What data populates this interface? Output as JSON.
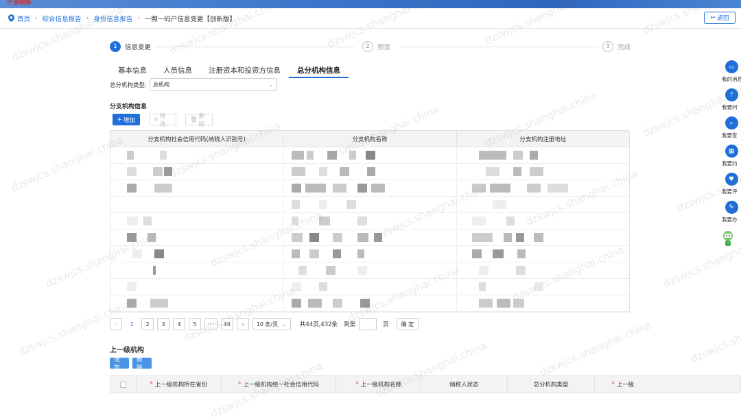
{
  "logo_text": "宁波税务",
  "breadcrumb": [
    "首页",
    "综合信息报告",
    "身份信息报告",
    "一照一码户信息变更【创新版】"
  ],
  "back_label": "返回",
  "steps": [
    {
      "num": "1",
      "label": "信息变更"
    },
    {
      "num": "2",
      "label": "预览"
    },
    {
      "num": "3",
      "label": "完成"
    }
  ],
  "tabs": [
    "基本信息",
    "人员信息",
    "注册资本和投资方信息",
    "总分机构信息"
  ],
  "org_type": {
    "label": "总分机构类型:",
    "value": "总机构"
  },
  "branch": {
    "title": "分支机构信息",
    "buttons": {
      "add": "增加",
      "edit": "修改",
      "delete": "删除"
    },
    "columns": [
      "分支机构社会信用代码(纳税人识别号)",
      "分支机构名称",
      "分支机构注册地址"
    ]
  },
  "pager": {
    "pages": [
      "1",
      "2",
      "3",
      "4",
      "5",
      "•••",
      "44"
    ],
    "current": "1",
    "page_size": "10 条/页",
    "total": "共44页,432条",
    "goto_prefix": "到第",
    "goto_suffix": "页",
    "confirm": "确 定"
  },
  "superior": {
    "title": "上一级机构",
    "buttons": {
      "add": "增加",
      "delete": "删除"
    },
    "columns": [
      "上一级机构所在省份",
      "上一级机构统一社会信用代码",
      "上一级机构名称",
      "纳税人状态",
      "总分机构类型",
      "上一级"
    ]
  },
  "sidebar": [
    {
      "icon": "message-icon",
      "label": "我的消息"
    },
    {
      "icon": "question-icon",
      "label": "我要问"
    },
    {
      "icon": "search-icon",
      "label": "我要查"
    },
    {
      "icon": "calendar-icon",
      "label": "我要约"
    },
    {
      "icon": "thumb-icon",
      "label": "我要评"
    },
    {
      "icon": "pen-icon",
      "label": "我要办"
    }
  ],
  "watermark": "dzswjcs.shanghai.china",
  "colors": {
    "accent": "#1e6fd9"
  }
}
